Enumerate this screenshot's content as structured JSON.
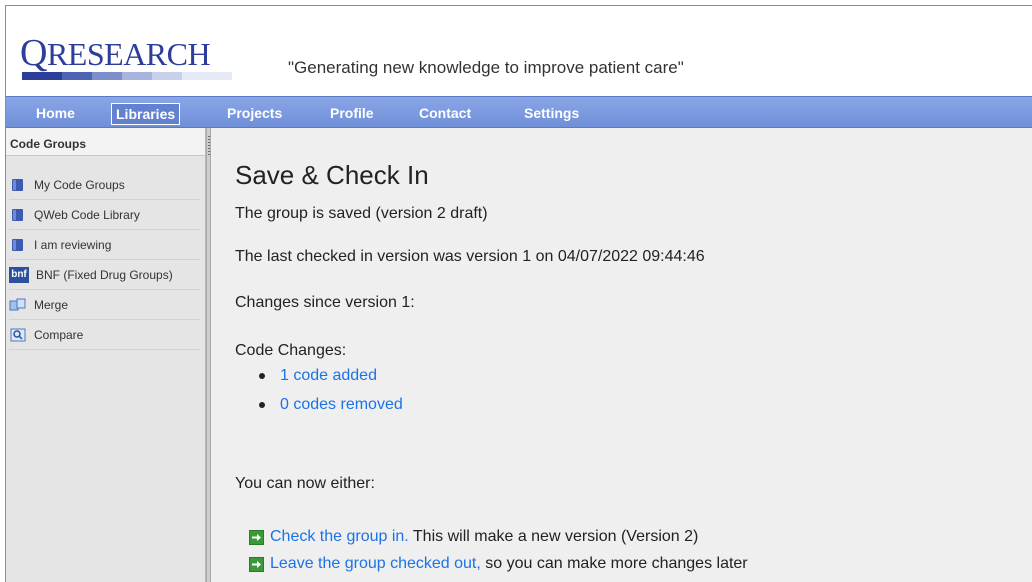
{
  "header": {
    "logo_q": "Q",
    "logo_rest": "RESEARCH",
    "tagline": "\"Generating new knowledge to improve patient care\""
  },
  "nav": {
    "items": [
      {
        "label": "Home"
      },
      {
        "label": "Libraries",
        "active": true
      },
      {
        "label": "Projects"
      },
      {
        "label": "Profile"
      },
      {
        "label": "Contact"
      },
      {
        "label": "Settings"
      }
    ]
  },
  "sidebar": {
    "title": "Code Groups",
    "items": [
      {
        "label": "My Code Groups",
        "icon": "book-icon"
      },
      {
        "label": "QWeb Code Library",
        "icon": "book-icon"
      },
      {
        "label": "I am reviewing",
        "icon": "book-icon"
      },
      {
        "label": "BNF (Fixed Drug Groups)",
        "icon": "bnf-icon",
        "icon_text": "bnf"
      },
      {
        "label": "Merge",
        "icon": "merge-icon"
      },
      {
        "label": "Compare",
        "icon": "compare-icon"
      }
    ]
  },
  "main": {
    "title": "Save & Check In",
    "saved_message": "The group is saved (version 2 draft)",
    "last_checked_in": "The last checked in version was version 1 on 04/07/2022 09:44:46",
    "changes_since": "Changes since version 1:",
    "code_changes_label": "Code Changes:",
    "code_changes": [
      {
        "label": "1 code added"
      },
      {
        "label": "0 codes removed"
      }
    ],
    "now_either": "You can now either:",
    "actions": [
      {
        "link": "Check the group in.",
        "text": " This will make a new version (Version 2)"
      },
      {
        "link": "Leave the group checked out,",
        "text": " so you can make more changes later"
      }
    ]
  },
  "colors": {
    "nav_bg": "#7b99df",
    "link": "#1a73e8",
    "logo": "#2c3e9a",
    "action_icon": "#3a9a3a"
  }
}
